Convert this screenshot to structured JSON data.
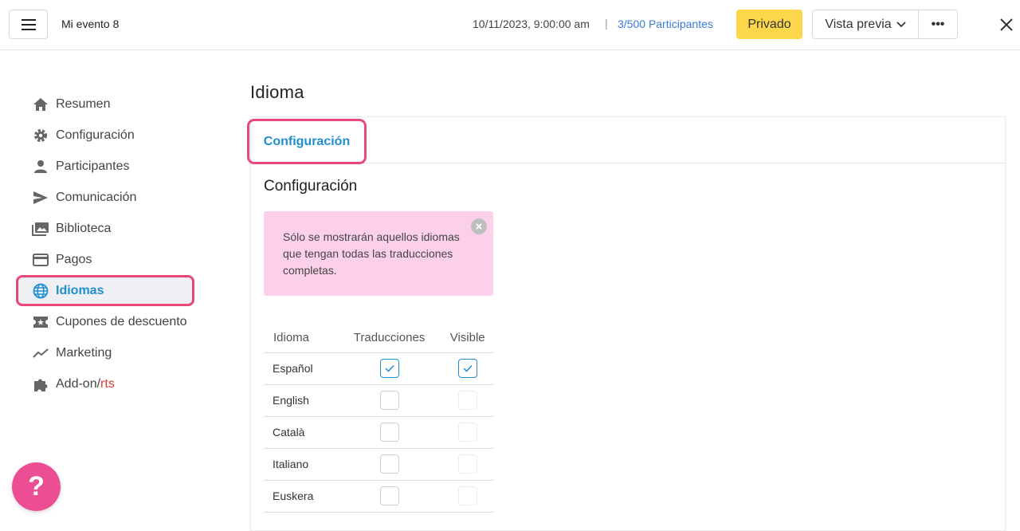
{
  "header": {
    "menu_icon": "hamburger-icon",
    "event_title": "Mi evento 8",
    "date": "10/11/2023, 9:00:00 am",
    "separator": "|",
    "participants_count": "3/500",
    "participants_label": "Participantes",
    "private_label": "Privado",
    "preview_label": "Vista previa",
    "more_label": "•••",
    "close_icon": "close-icon"
  },
  "sidebar": {
    "items": [
      {
        "label": "Resumen",
        "icon": "home-icon"
      },
      {
        "label": "Configuración",
        "icon": "gear-icon"
      },
      {
        "label": "Participantes",
        "icon": "person-icon"
      },
      {
        "label": "Comunicación",
        "icon": "send-icon"
      },
      {
        "label": "Biblioteca",
        "icon": "images-icon"
      },
      {
        "label": "Pagos",
        "icon": "credit-card-icon"
      },
      {
        "label": "Idiomas",
        "icon": "globe-icon"
      },
      {
        "label": "Cupones de descuento",
        "icon": "ticket-icon"
      },
      {
        "label": "Marketing",
        "icon": "trend-icon"
      },
      {
        "label": "Add-on/",
        "label_suffix": "rts",
        "icon": "puzzle-icon"
      }
    ],
    "active_index": 6
  },
  "main": {
    "page_title": "Idioma",
    "tabs": [
      {
        "label": "Configuración"
      }
    ],
    "section_title": "Configuración",
    "alert_text": "Sólo se mostrarán aquellos idiomas que tengan todas las traducciones completas.",
    "table": {
      "headers": [
        "Idioma",
        "Traducciones",
        "Visible"
      ],
      "rows": [
        {
          "language": "Español",
          "translations": true,
          "visible": true
        },
        {
          "language": "English",
          "translations": false,
          "visible": false
        },
        {
          "language": "Català",
          "translations": false,
          "visible": false
        },
        {
          "language": "Italiano",
          "translations": false,
          "visible": false
        },
        {
          "language": "Euskera",
          "translations": false,
          "visible": false
        }
      ]
    }
  },
  "help_label": "?",
  "colors": {
    "accent_blue": "#1f8fcf",
    "highlight_pink": "#e8487a",
    "alert_bg": "#fcd0ea",
    "private_yellow": "#fcd74a",
    "help_pink": "#ec4e94"
  }
}
